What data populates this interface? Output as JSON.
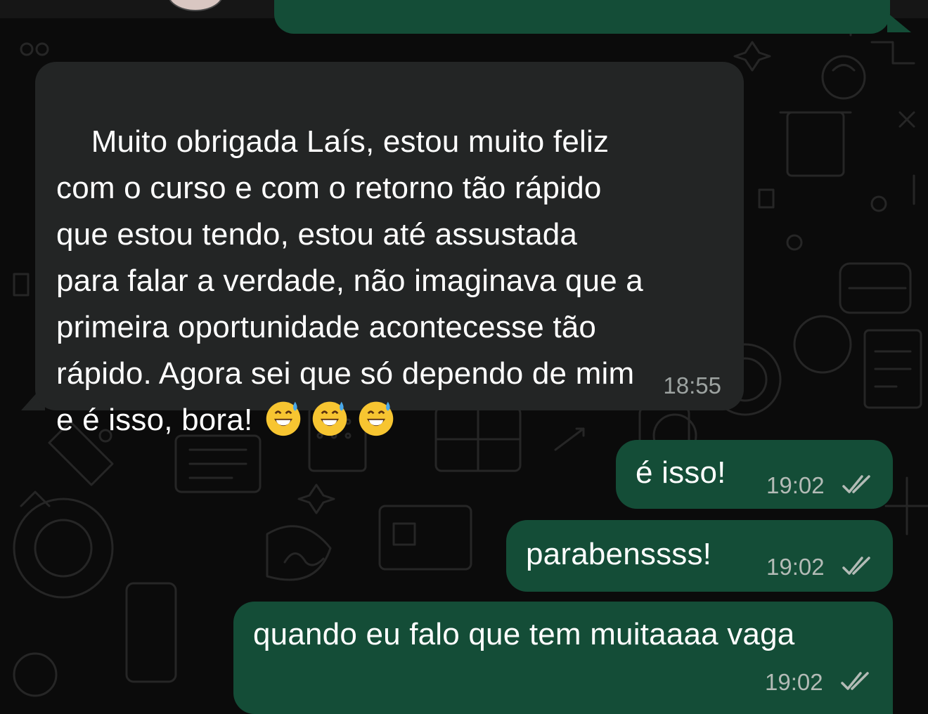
{
  "messages": [
    {
      "direction": "incoming",
      "text": "Muito obrigada Laís, estou muito feliz\ncom o curso e com o retorno tão rápido\nque estou tendo, estou até assustada\npara falar a verdade, não imaginava que a\nprimeira oportunidade acontecesse tão\nrápido. Agora sei que só dependo de mim\ne é isso, bora!",
      "emoji": [
        "grinning-face-with-sweat-icon",
        "grinning-face-with-sweat-icon",
        "grinning-face-with-sweat-icon"
      ],
      "time": "18:55"
    },
    {
      "direction": "outgoing",
      "text": "é isso!",
      "time": "19:02",
      "status": "read"
    },
    {
      "direction": "outgoing",
      "text": "parabenssss!",
      "time": "19:02",
      "status": "read"
    },
    {
      "direction": "outgoing",
      "text": "quando eu falo que tem muitaaaa vaga",
      "time": "19:02",
      "status": "read"
    }
  ],
  "colors": {
    "incoming_bubble": "#232525",
    "outgoing_bubble": "#144d37",
    "background": "#0b0b0b",
    "read_ticks": "#b3bbb6"
  }
}
